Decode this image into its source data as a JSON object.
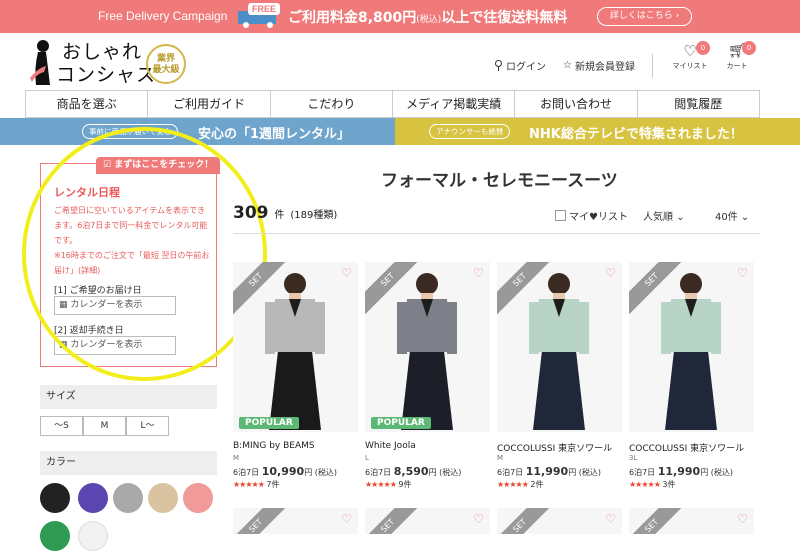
{
  "banner": {
    "campaign": "Free Delivery Campaign",
    "free_label": "FREE",
    "message": "ご利用料金8,800円",
    "tax_note": "(税込)",
    "message_tail": "以上で往復送料無料",
    "details_button": "詳しくはこちら ›"
  },
  "header": {
    "logo_line1": "おしゃれ",
    "logo_line2": "コンシャス",
    "badge_line1": "業界",
    "badge_line2": "最大級",
    "login": "ログイン",
    "register": "新規会員登録",
    "mylist_label": "マイリスト",
    "mylist_count": "0",
    "cart_label": "カート",
    "cart_count": "0"
  },
  "nav": [
    "商品を選ぶ",
    "ご利用ガイド",
    "こだわり",
    "メディア掲載実績",
    "お問い合わせ",
    "閲覧履歴"
  ],
  "bands": {
    "left_pill": "事前に商品が届いて安心",
    "left_text": "安心の「1週間レンタル」",
    "right_pill": "アナウンサーも絶賛",
    "right_text": "NHK総合テレビで特集されました！"
  },
  "schedule": {
    "tab": "まずはここをチェック！",
    "title": "レンタル日程",
    "desc1": "ご希望日に空いているアイテムを表示できます。6泊7日まで同一料金でレンタル可能です。",
    "desc2": "※16時までのご注文で「最短 翌日の午前お届け」(詳細)",
    "field1_label": "[1] ご希望のお届け日",
    "field1_placeholder": "カレンダーを表示",
    "field2_label": "[2] 返却手続き日",
    "field2_placeholder": "カレンダーを表示"
  },
  "facets": {
    "size_title": "サイズ",
    "sizes": [
      "〜S",
      "M",
      "L〜"
    ],
    "color_title": "カラー",
    "colors": [
      "#222222",
      "#5b45b0",
      "#a9a9a9",
      "#d9c3a0",
      "#f09a9a",
      "#2e9a52",
      "#f2f2f2"
    ]
  },
  "results": {
    "title": "フォーマル・セレモニースーツ",
    "count": "309",
    "count_unit": "件",
    "count_detail": "(189種類)",
    "favorites_filter": "マイ♥リスト",
    "sort": "人気順",
    "per_page": "40件"
  },
  "products": [
    {
      "set_label": "SET",
      "badge": "POPULAR",
      "brand": "B:MING by BEAMS",
      "size": "M",
      "nights": "6泊7日",
      "price": "10,990",
      "tax": "円 (税込)",
      "stars": "★★★★★",
      "reviews": "7件",
      "jacket": "#b8b8b8",
      "dress": "#1a1a1a"
    },
    {
      "set_label": "SET",
      "badge": "POPULAR",
      "brand": "White Joola",
      "size": "L",
      "nights": "6泊7日",
      "price": "8,590",
      "tax": "円 (税込)",
      "stars": "★★★★★",
      "reviews": "9件",
      "jacket": "#7d8088",
      "dress": "#1c1f28"
    },
    {
      "set_label": "SET",
      "badge": "",
      "brand": "COCCOLUSSI 東京ソワール",
      "size": "M",
      "nights": "6泊7日",
      "price": "11,990",
      "tax": "円 (税込)",
      "stars": "★★★★★",
      "reviews": "2件",
      "jacket": "#b8d4c6",
      "dress": "#1f2738"
    },
    {
      "set_label": "SET",
      "badge": "",
      "brand": "COCCOLUSSI 東京ソワール",
      "size": "3L",
      "nights": "6泊7日",
      "price": "11,990",
      "tax": "円 (税込)",
      "stars": "★★★★★",
      "reviews": "3件",
      "jacket": "#b8d4c6",
      "dress": "#1f2738"
    }
  ],
  "second_row_set_label": "SET"
}
